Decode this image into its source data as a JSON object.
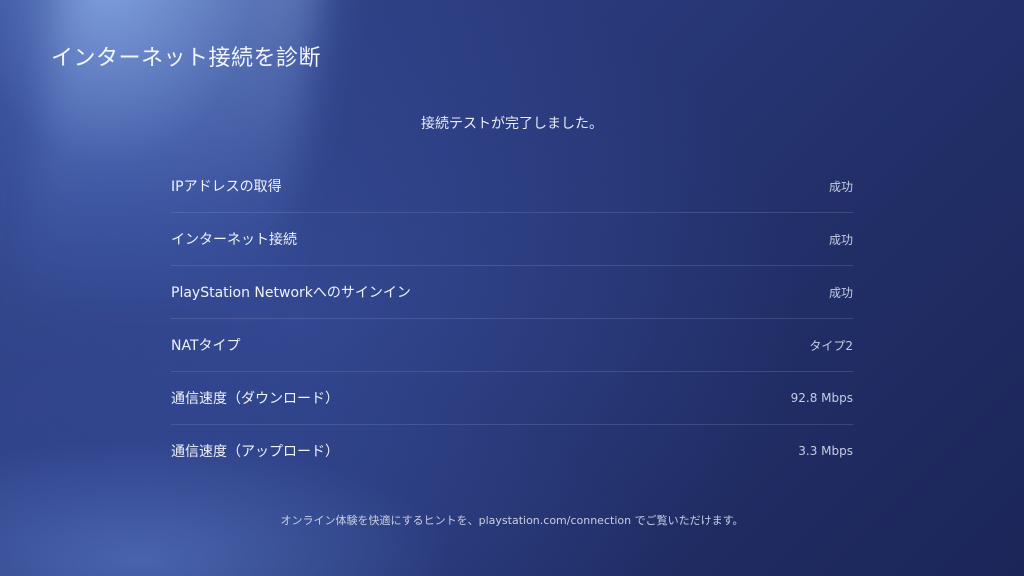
{
  "header": {
    "title": "インターネット接続を診断"
  },
  "status_message": "接続テストが完了しました。",
  "results": [
    {
      "label": "IPアドレスの取得",
      "value": "成功"
    },
    {
      "label": "インターネット接続",
      "value": "成功"
    },
    {
      "label": "PlayStation Networkへのサインイン",
      "value": "成功"
    },
    {
      "label": "NATタイプ",
      "value": "タイプ2"
    },
    {
      "label": "通信速度（ダウンロード）",
      "value": "92.8 Mbps"
    },
    {
      "label": "通信速度（アップロード）",
      "value": "3.3 Mbps"
    }
  ],
  "footer": {
    "hint": "オンライン体験を快適にするヒントを、playstation.com/connection でご覧いただけます。"
  }
}
